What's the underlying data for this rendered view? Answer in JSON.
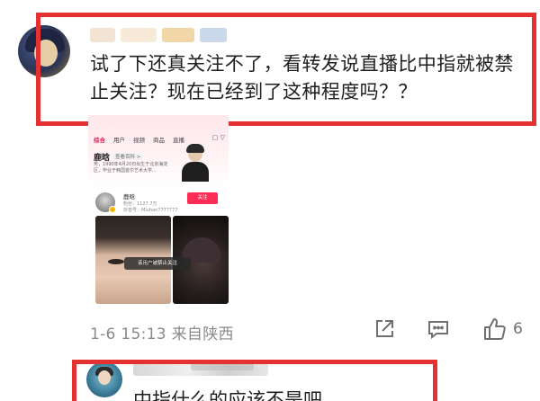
{
  "comment1": {
    "text": "试了下还真关注不了，看转发说直播比中指就被禁止关注？现在已经到了这种程度吗？？",
    "time": "1-6 15:13",
    "source": "来自陕西",
    "like_count": "6",
    "highlight_color": "#e63131"
  },
  "embedded_screenshot": {
    "tabs": [
      "综合",
      "用户",
      "视频",
      "商品",
      "直播"
    ],
    "active_tab": "综合",
    "profile_name": "鹿晗",
    "baike_label": "查看百科 >",
    "description": "男，1990年4月20日出生于北京海淀区，毕业于韩国首尔艺术大学...",
    "user_name": "鹿晗",
    "fans": "粉丝：1127.7万",
    "douyin_id": "抖音号：Miuhan7777777",
    "follow_label": "关注",
    "toast": "该用户被禁止关注",
    "accent_color": "#fe2c55"
  },
  "comment2": {
    "text": "中指什么的应该不是吧"
  },
  "icons": [
    "share-icon",
    "comment-icon",
    "like-icon"
  ]
}
